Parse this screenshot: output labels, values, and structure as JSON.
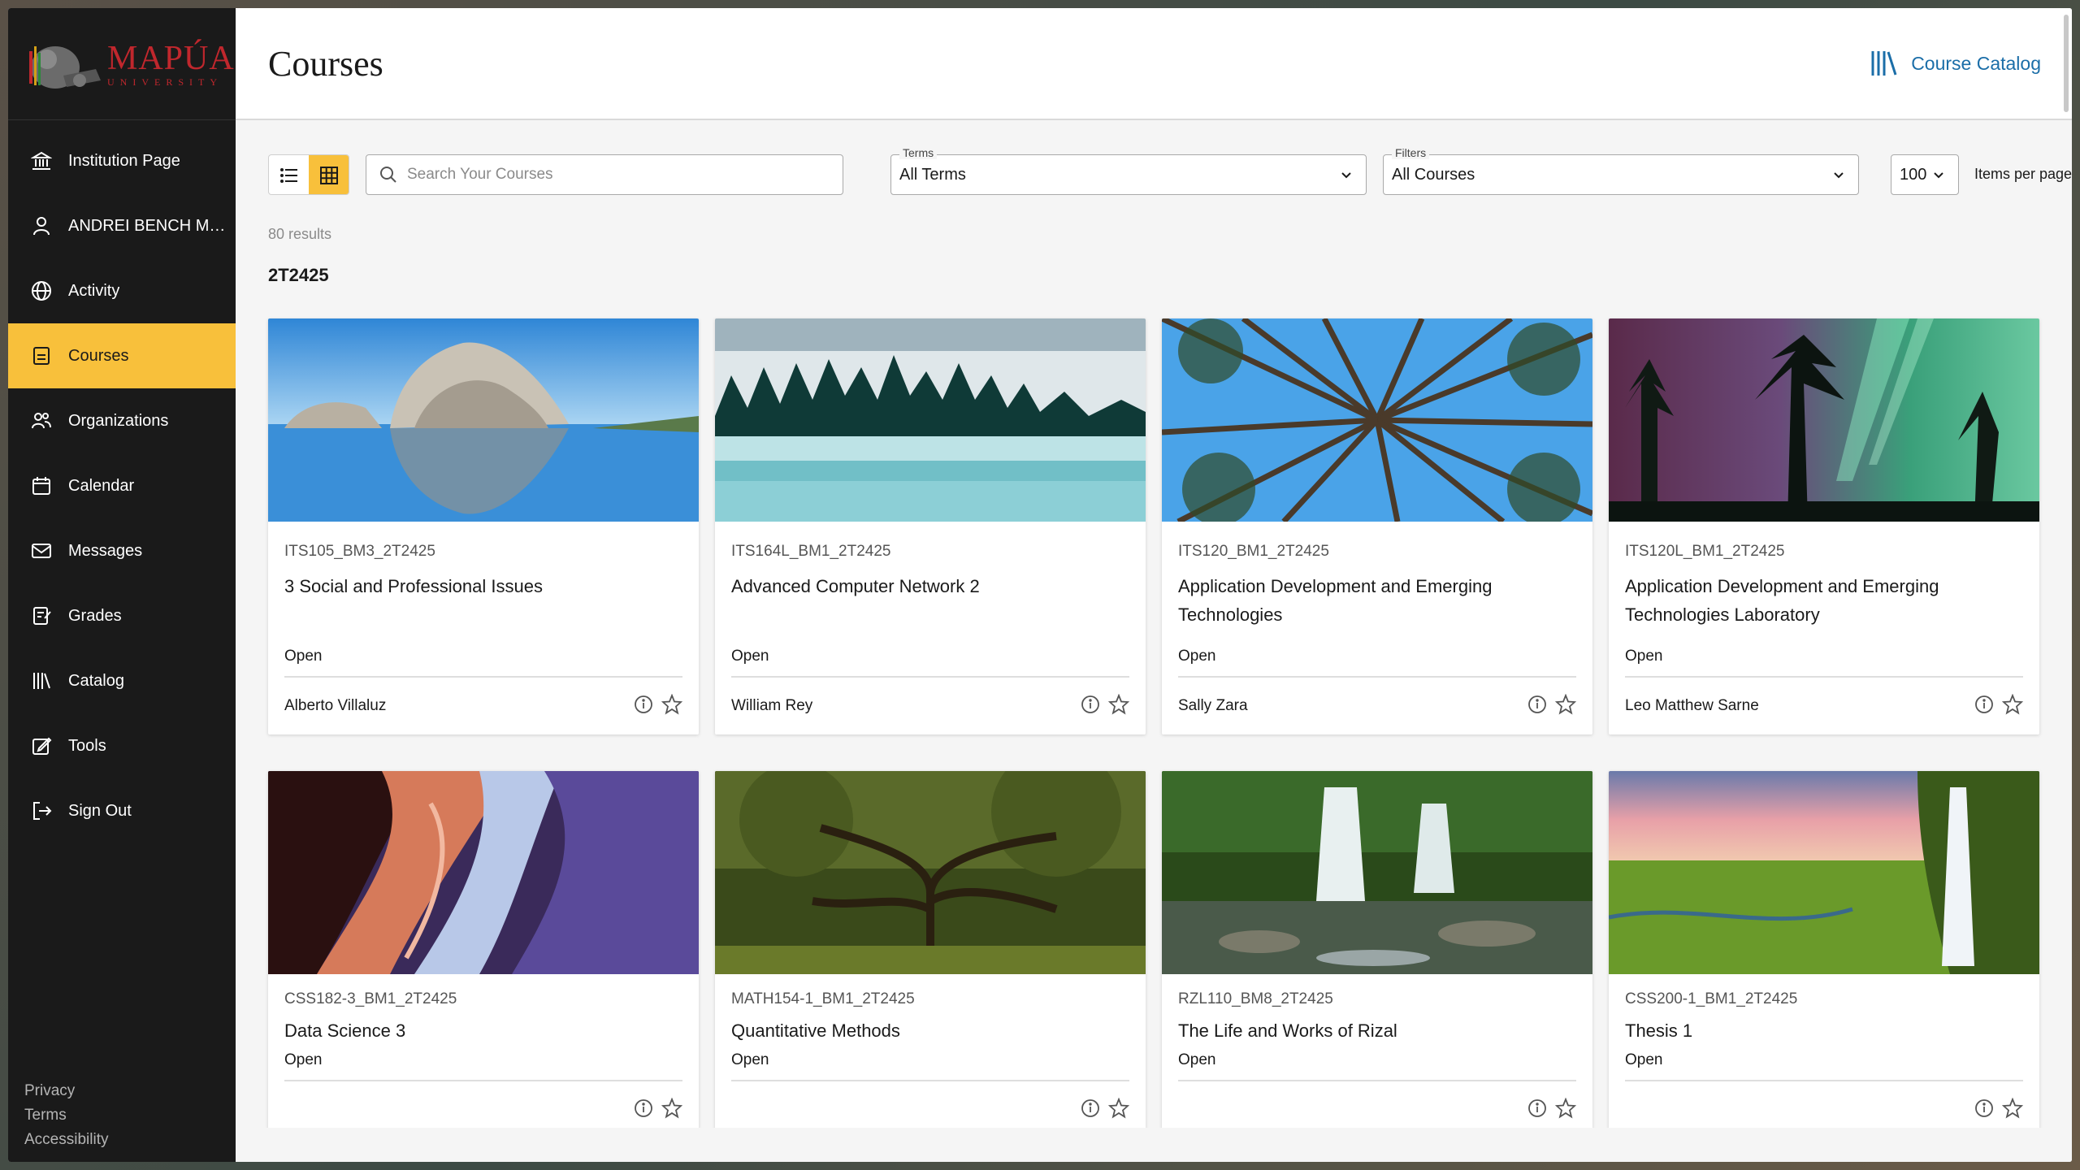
{
  "brand": {
    "name": "MAPÚA",
    "sub": "UNIVERSITY",
    "color": "#c0272d"
  },
  "sidebar": {
    "items": [
      {
        "label": "Institution Page",
        "icon": "institution-icon"
      },
      {
        "label": "ANDREI BENCH MAL...",
        "icon": "user-icon"
      },
      {
        "label": "Activity",
        "icon": "globe-icon"
      },
      {
        "label": "Courses",
        "icon": "courses-icon",
        "active": true
      },
      {
        "label": "Organizations",
        "icon": "organizations-icon"
      },
      {
        "label": "Calendar",
        "icon": "calendar-icon"
      },
      {
        "label": "Messages",
        "icon": "mail-icon"
      },
      {
        "label": "Grades",
        "icon": "grades-icon"
      },
      {
        "label": "Catalog",
        "icon": "catalog-icon"
      },
      {
        "label": "Tools",
        "icon": "tools-icon"
      },
      {
        "label": "Sign Out",
        "icon": "sign-out-icon"
      }
    ],
    "footer": [
      "Privacy",
      "Terms",
      "Accessibility"
    ],
    "accent": "#f8c03b"
  },
  "header": {
    "title": "Courses",
    "catalog_link": "Course Catalog"
  },
  "toolbar": {
    "search_placeholder": "Search Your Courses",
    "terms_label": "Terms",
    "terms_value": "All Terms",
    "filters_label": "Filters",
    "filters_value": "All Courses",
    "per_page_value": "100",
    "per_page_label": "Items per page"
  },
  "results": "80 results",
  "term": "2T2425",
  "courses": [
    {
      "code": "ITS105_BM3_2T2425",
      "name": "3 Social and Professional Issues",
      "status": "Open",
      "instructor": "Alberto Villaluz"
    },
    {
      "code": "ITS164L_BM1_2T2425",
      "name": "Advanced Computer Network 2",
      "status": "Open",
      "instructor": "William Rey"
    },
    {
      "code": "ITS120_BM1_2T2425",
      "name": "Application Development and Emerging Technologies",
      "status": "Open",
      "instructor": "Sally Zara"
    },
    {
      "code": "ITS120L_BM1_2T2425",
      "name": "Application Development and Emerging Technologies Laboratory",
      "status": "Open",
      "instructor": "Leo Matthew Sarne"
    },
    {
      "code": "CSS182-3_BM1_2T2425",
      "name": "Data Science 3",
      "status": "Open",
      "instructor": ""
    },
    {
      "code": "MATH154-1_BM1_2T2425",
      "name": "Quantitative Methods",
      "status": "Open",
      "instructor": ""
    },
    {
      "code": "RZL110_BM8_2T2425",
      "name": "The Life and Works of Rizal",
      "status": "Open",
      "instructor": ""
    },
    {
      "code": "CSS200-1_BM1_2T2425",
      "name": "Thesis 1",
      "status": "Open",
      "instructor": ""
    }
  ]
}
